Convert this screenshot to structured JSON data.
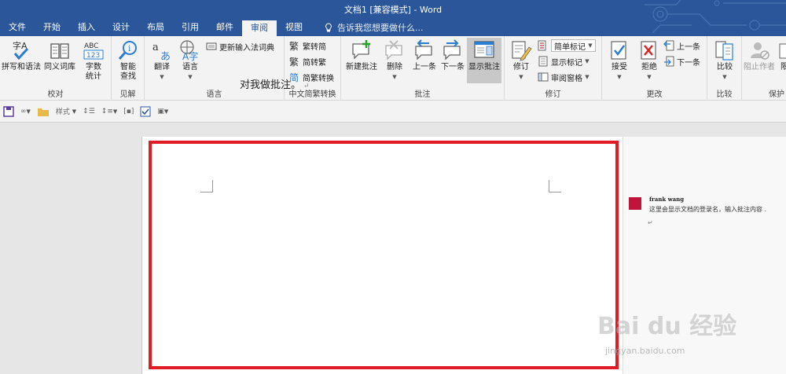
{
  "window": {
    "title": "文档1 [兼容模式] - Word"
  },
  "tabs": [
    {
      "label": "文件"
    },
    {
      "label": "开始"
    },
    {
      "label": "插入"
    },
    {
      "label": "设计"
    },
    {
      "label": "布局"
    },
    {
      "label": "引用"
    },
    {
      "label": "邮件"
    },
    {
      "label": "审阅",
      "active": true
    },
    {
      "label": "视图"
    }
  ],
  "tell_me": {
    "placeholder": "告诉我您想要做什么..."
  },
  "ribbon": {
    "proofing": {
      "label": "校对",
      "spelling": "拼写和语法",
      "thesaurus": "同义词库",
      "wordcount_l1": "字数",
      "wordcount_l2": "统计"
    },
    "insights": {
      "label": "见解",
      "smart_l1": "智能",
      "smart_l2": "查找"
    },
    "language": {
      "label": "语言",
      "translate": "翻译",
      "language": "语言",
      "ime_dict": "更新输入法词典"
    },
    "chinese": {
      "label": "中文简繁转换",
      "to_trad": "繁转简",
      "to_simp": "简转繁",
      "convert": "简繁转换"
    },
    "comments": {
      "label": "批注",
      "new": "新建批注",
      "delete": "删除",
      "prev": "上一条",
      "next": "下一条",
      "show": "显示批注"
    },
    "tracking": {
      "label": "修订",
      "track": "修订",
      "markup_select": "简单标记",
      "show_markup": "显示标记",
      "review_pane": "审阅窗格"
    },
    "changes": {
      "label": "更改",
      "accept": "接受",
      "reject": "拒绝",
      "prev": "上一条",
      "next": "下一条"
    },
    "compare": {
      "label": "比较",
      "compare": "比较"
    },
    "protect": {
      "label": "保护",
      "block_authors": "阻止作者",
      "restrict": "限"
    }
  },
  "qat": {
    "item1": "样式"
  },
  "document": {
    "text": "对我做批注。",
    "para_mark": "↵"
  },
  "comment": {
    "author": "frank wang",
    "text": "这里会显示文档的登录名，输入批注内容 .",
    "mark": "↵"
  },
  "watermark": {
    "brand": "Bai du 经验",
    "url": "jingyan.baidu.com"
  },
  "colors": {
    "accent": "#2b579a",
    "highlight": "#e01b24",
    "avatar": "#c0143c"
  }
}
